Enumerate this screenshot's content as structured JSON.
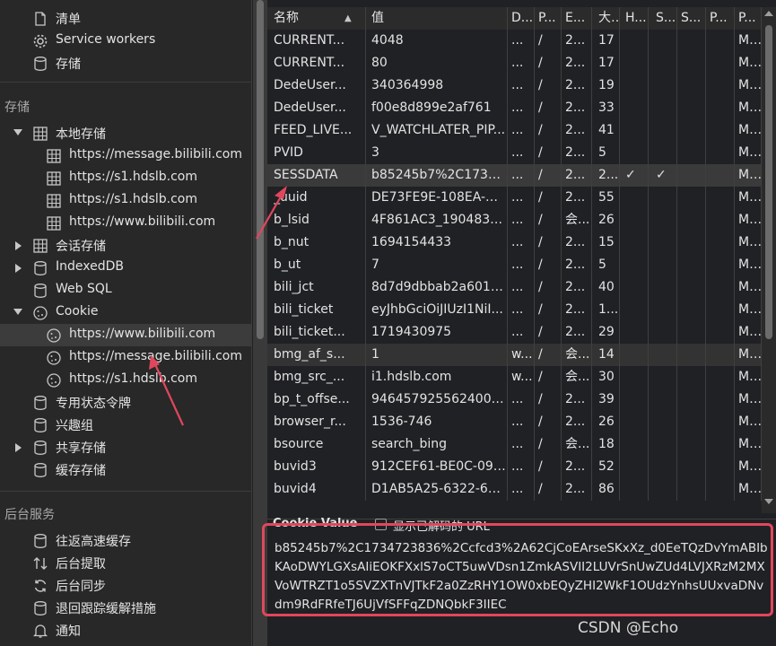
{
  "sidebar": {
    "top_items": [
      {
        "label": "清单",
        "icon": "file-icon"
      },
      {
        "label": "Service workers",
        "icon": "gear-icon"
      },
      {
        "label": "存储",
        "icon": "database-icon"
      }
    ],
    "storage_header": "存储",
    "local_storage": {
      "label": "本地存储",
      "expanded": true,
      "children": [
        "https://message.bilibili.com",
        "https://s1.hdslb.com",
        "https://s1.hdslb.com",
        "https://www.bilibili.com"
      ]
    },
    "session_storage": "会话存储",
    "indexeddb": "IndexedDB",
    "websql": "Web SQL",
    "cookie": {
      "label": "Cookie",
      "expanded": true,
      "children": [
        "https://www.bilibili.com",
        "https://message.bilibili.com",
        "https://s1.hdslb.com"
      ],
      "selected_index": 0
    },
    "private_state_tokens": "专用状态令牌",
    "interest_groups": "兴趣组",
    "shared_storage": "共享存储",
    "cache_storage": "缓存存储",
    "bg_header": "后台服务",
    "bg_items": [
      {
        "label": "往返高速缓存",
        "icon": "database-icon"
      },
      {
        "label": "后台提取",
        "icon": "arrows-updown-icon"
      },
      {
        "label": "后台同步",
        "icon": "sync-icon"
      },
      {
        "label": "退回跟踪缓解措施",
        "icon": "database-icon"
      },
      {
        "label": "通知",
        "icon": "bell-icon"
      }
    ]
  },
  "table": {
    "columns": [
      "名称",
      "值",
      "D...",
      "P...",
      "E...",
      "大...",
      "H...",
      "S...",
      "S...",
      "P...",
      "P..."
    ],
    "sort_indicator": "▲",
    "rows": [
      [
        "CURRENT...",
        "4048",
        "...",
        "/",
        "2...",
        "17",
        "",
        "",
        "",
        "",
        "M..."
      ],
      [
        "CURRENT...",
        "80",
        "...",
        "/",
        "2...",
        "17",
        "",
        "",
        "",
        "",
        "M..."
      ],
      [
        "DedeUser...",
        "340364998",
        "...",
        "/",
        "2...",
        "19",
        "",
        "",
        "",
        "",
        "M..."
      ],
      [
        "DedeUser...",
        "f00e8d899e2af761",
        "...",
        "/",
        "2...",
        "33",
        "",
        "",
        "",
        "",
        "M..."
      ],
      [
        "FEED_LIVE...",
        "V_WATCHLATER_PIP...",
        "...",
        "/",
        "2...",
        "41",
        "",
        "",
        "",
        "",
        "M..."
      ],
      [
        "PVID",
        "3",
        "...",
        "/",
        "2...",
        "5",
        "",
        "",
        "",
        "",
        "M..."
      ],
      [
        "SESSDATA",
        "b85245b7%2C1734...",
        "...",
        "/",
        "2...",
        "2...",
        "✓",
        "✓",
        "",
        "",
        "M..."
      ],
      [
        "_uuid",
        "DE73FE9E-108EA-D...",
        "...",
        "/",
        "2...",
        "55",
        "",
        "",
        "",
        "",
        "M..."
      ],
      [
        "b_lsid",
        "4F861AC3_190483E...",
        "...",
        "/",
        "会...",
        "26",
        "",
        "",
        "",
        "",
        "M..."
      ],
      [
        "b_nut",
        "1694154433",
        "...",
        "/",
        "2...",
        "15",
        "",
        "",
        "",
        "",
        "M..."
      ],
      [
        "b_ut",
        "7",
        "...",
        "/",
        "2...",
        "5",
        "",
        "",
        "",
        "",
        "M..."
      ],
      [
        "bili_jct",
        "8d7d9dbbab2a6013...",
        "...",
        "/",
        "2...",
        "40",
        "",
        "",
        "",
        "",
        "M..."
      ],
      [
        "bili_ticket",
        "eyJhbGciOiJIUzI1NiI...",
        "...",
        "/",
        "2...",
        "1...",
        "",
        "",
        "",
        "",
        "M..."
      ],
      [
        "bili_ticket...",
        "1719430975",
        "...",
        "/",
        "2...",
        "29",
        "",
        "",
        "",
        "",
        "M..."
      ],
      [
        "bmg_af_s...",
        "1",
        "w...",
        "/",
        "会...",
        "14",
        "",
        "",
        "",
        "",
        "M..."
      ],
      [
        "bmg_src_...",
        "i1.hdslb.com",
        "w...",
        "/",
        "会...",
        "30",
        "",
        "",
        "",
        "",
        "M..."
      ],
      [
        "bp_t_offse...",
        "9464579255624007...",
        "...",
        "/",
        "2...",
        "39",
        "",
        "",
        "",
        "",
        "M..."
      ],
      [
        "browser_r...",
        "1536-746",
        "...",
        "/",
        "2...",
        "26",
        "",
        "",
        "",
        "",
        "M..."
      ],
      [
        "bsource",
        "search_bing",
        "...",
        "/",
        "会...",
        "18",
        "",
        "",
        "",
        "",
        "M..."
      ],
      [
        "buvid3",
        "912CEF61-BE0C-09E...",
        "...",
        "/",
        "2...",
        "52",
        "",
        "",
        "",
        "",
        "M..."
      ],
      [
        "buvid4",
        "D1AB5A25-6322-65...",
        "...",
        "/",
        "2...",
        "86",
        "",
        "",
        "",
        "",
        "M..."
      ]
    ],
    "selected_row": 6,
    "alt_row": 14
  },
  "cookie_value": {
    "title": "Cookie Value",
    "show_decoded_label": "显示已解码的 URL",
    "value": "b85245b7%2C1734723836%2Ccfcd3%2A62CjCoEArseSKxXz_d0EeTQzDvYmABIbKAoDWYLGXsAIiEOKFXxlS7oCT5uwVDsn1ZmkASVII2LUVrSnUwZUd4LVJXRzM2MXVoWTRZT1o5SVZXTnVJTkF2a0ZzRHY1OW0xbEQyZHI2WkF1OUdzYnhsUUxvaDNvdm9RdFRfeTJ6UjVfSFFqZDNQbkF3IIEC"
  },
  "watermark": "CSDN @Echo",
  "colors": {
    "annotation": "#e0475d"
  }
}
